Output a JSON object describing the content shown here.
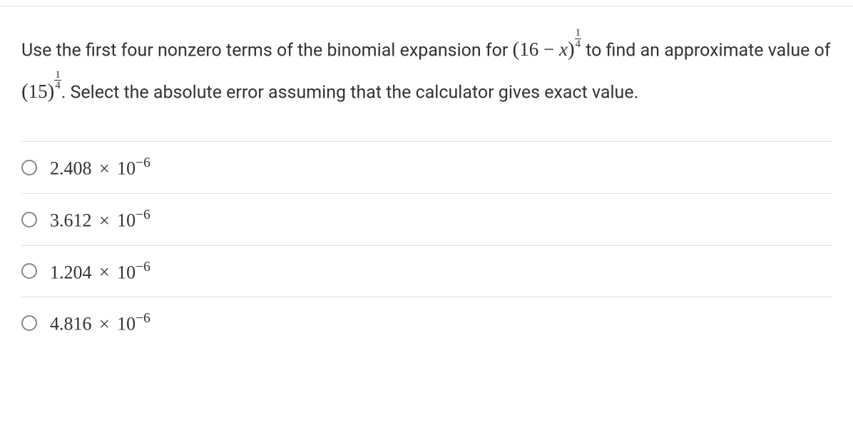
{
  "question": {
    "part1": "Use the first four nonzero terms of the binomial expansion for ",
    "expr1_open": "(",
    "expr1_base": "16",
    "expr1_minus": " − ",
    "expr1_var": "x",
    "expr1_close": ")",
    "frac_num": "1",
    "frac_den": "4",
    "part2": " to find an approximate value of ",
    "expr2_open": "(",
    "expr2_base": "15",
    "expr2_close": ")",
    "part3": ". Select the absolute error assuming that the calculator gives exact value."
  },
  "options": [
    {
      "coef": "2.408",
      "times": "×",
      "base": "10",
      "exp": "−6"
    },
    {
      "coef": "3.612",
      "times": "×",
      "base": "10",
      "exp": "−6"
    },
    {
      "coef": "1.204",
      "times": "×",
      "base": "10",
      "exp": "−6"
    },
    {
      "coef": "4.816",
      "times": "×",
      "base": "10",
      "exp": "−6"
    }
  ]
}
